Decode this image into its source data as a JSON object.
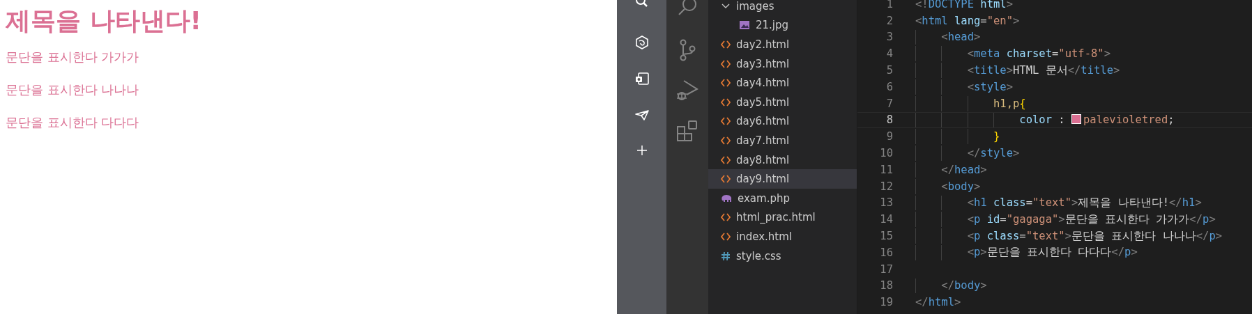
{
  "preview": {
    "heading": "제목을 나타낸다!",
    "paragraphs": [
      "문단을 표시한다 가가가",
      "문단을 표시한다 나나나",
      "문단을 표시한다 다다다"
    ]
  },
  "explorer": {
    "items": [
      {
        "name": "images",
        "kind": "folder",
        "expanded": true,
        "selected": false,
        "children": [
          {
            "name": "21.jpg",
            "kind": "image",
            "selected": false
          }
        ]
      },
      {
        "name": "day2.html",
        "kind": "html",
        "selected": false
      },
      {
        "name": "day3.html",
        "kind": "html",
        "selected": false
      },
      {
        "name": "day4.html",
        "kind": "html",
        "selected": false
      },
      {
        "name": "day5.html",
        "kind": "html",
        "selected": false
      },
      {
        "name": "day6.html",
        "kind": "html",
        "selected": false
      },
      {
        "name": "day7.html",
        "kind": "html",
        "selected": false
      },
      {
        "name": "day8.html",
        "kind": "html",
        "selected": false
      },
      {
        "name": "day9.html",
        "kind": "html",
        "selected": true
      },
      {
        "name": "exam.php",
        "kind": "php",
        "selected": false
      },
      {
        "name": "html_prac.html",
        "kind": "html",
        "selected": false
      },
      {
        "name": "index.html",
        "kind": "html",
        "selected": false
      },
      {
        "name": "style.css",
        "kind": "css",
        "selected": false
      }
    ]
  },
  "editor": {
    "lines": [
      {
        "number": "1",
        "current": false,
        "tokens": [
          {
            "text": "<!",
            "kind": "punct"
          },
          {
            "text": "DOCTYPE",
            "kind": "tag"
          },
          {
            "text": " html",
            "kind": "attr"
          },
          {
            "text": ">",
            "kind": "punct"
          }
        ]
      },
      {
        "number": "2",
        "current": false,
        "tokens": [
          {
            "text": "<",
            "kind": "punct"
          },
          {
            "text": "html",
            "kind": "tag"
          },
          {
            "text": " lang",
            "kind": "attr"
          },
          {
            "text": "=",
            "kind": "text"
          },
          {
            "text": "\"en\"",
            "kind": "string"
          },
          {
            "text": ">",
            "kind": "punct"
          }
        ]
      },
      {
        "number": "3",
        "current": false,
        "tokens": [
          {
            "text": "    <",
            "kind": "punct"
          },
          {
            "text": "head",
            "kind": "tag"
          },
          {
            "text": ">",
            "kind": "punct"
          }
        ]
      },
      {
        "number": "4",
        "current": false,
        "tokens": [
          {
            "text": "        <",
            "kind": "punct"
          },
          {
            "text": "meta",
            "kind": "tag"
          },
          {
            "text": " charset",
            "kind": "attr"
          },
          {
            "text": "=",
            "kind": "text"
          },
          {
            "text": "\"utf-8\"",
            "kind": "string"
          },
          {
            "text": ">",
            "kind": "punct"
          }
        ]
      },
      {
        "number": "5",
        "current": false,
        "tokens": [
          {
            "text": "        <",
            "kind": "punct"
          },
          {
            "text": "title",
            "kind": "tag"
          },
          {
            "text": ">",
            "kind": "punct"
          },
          {
            "text": "HTML 문서",
            "kind": "text"
          },
          {
            "text": "</",
            "kind": "punct"
          },
          {
            "text": "title",
            "kind": "tag"
          },
          {
            "text": ">",
            "kind": "punct"
          }
        ]
      },
      {
        "number": "6",
        "current": false,
        "tokens": [
          {
            "text": "        <",
            "kind": "punct"
          },
          {
            "text": "style",
            "kind": "tag"
          },
          {
            "text": ">",
            "kind": "punct"
          }
        ]
      },
      {
        "number": "7",
        "current": false,
        "tokens": [
          {
            "text": "            h1,p",
            "kind": "selector"
          },
          {
            "text": "{",
            "kind": "brace"
          }
        ]
      },
      {
        "number": "8",
        "current": true,
        "tokens": [
          {
            "text": "                color",
            "kind": "attr"
          },
          {
            "text": " : ",
            "kind": "text"
          },
          {
            "text": "palevioletred",
            "kind": "string",
            "color": "#db7093"
          },
          {
            "text": ";",
            "kind": "text"
          }
        ]
      },
      {
        "number": "9",
        "current": false,
        "tokens": [
          {
            "text": "            }",
            "kind": "brace"
          }
        ]
      },
      {
        "number": "10",
        "current": false,
        "tokens": [
          {
            "text": "        </",
            "kind": "punct"
          },
          {
            "text": "style",
            "kind": "tag"
          },
          {
            "text": ">",
            "kind": "punct"
          }
        ]
      },
      {
        "number": "11",
        "current": false,
        "tokens": [
          {
            "text": "    </",
            "kind": "punct"
          },
          {
            "text": "head",
            "kind": "tag"
          },
          {
            "text": ">",
            "kind": "punct"
          }
        ]
      },
      {
        "number": "12",
        "current": false,
        "tokens": [
          {
            "text": "    <",
            "kind": "punct"
          },
          {
            "text": "body",
            "kind": "tag"
          },
          {
            "text": ">",
            "kind": "punct"
          }
        ]
      },
      {
        "number": "13",
        "current": false,
        "tokens": [
          {
            "text": "        <",
            "kind": "punct"
          },
          {
            "text": "h1",
            "kind": "tag"
          },
          {
            "text": " class",
            "kind": "attr"
          },
          {
            "text": "=",
            "kind": "text"
          },
          {
            "text": "\"text\"",
            "kind": "string"
          },
          {
            "text": ">",
            "kind": "punct"
          },
          {
            "text": "제목을 나타낸다!",
            "kind": "text"
          },
          {
            "text": "</",
            "kind": "punct"
          },
          {
            "text": "h1",
            "kind": "tag"
          },
          {
            "text": ">",
            "kind": "punct"
          }
        ]
      },
      {
        "number": "14",
        "current": false,
        "tokens": [
          {
            "text": "        <",
            "kind": "punct"
          },
          {
            "text": "p",
            "kind": "tag"
          },
          {
            "text": " id",
            "kind": "attr"
          },
          {
            "text": "=",
            "kind": "text"
          },
          {
            "text": "\"gagaga\"",
            "kind": "string"
          },
          {
            "text": ">",
            "kind": "punct"
          },
          {
            "text": "문단을 표시한다 가가가",
            "kind": "text"
          },
          {
            "text": "</",
            "kind": "punct"
          },
          {
            "text": "p",
            "kind": "tag"
          },
          {
            "text": ">",
            "kind": "punct"
          }
        ]
      },
      {
        "number": "15",
        "current": false,
        "tokens": [
          {
            "text": "        <",
            "kind": "punct"
          },
          {
            "text": "p",
            "kind": "tag"
          },
          {
            "text": " class",
            "kind": "attr"
          },
          {
            "text": "=",
            "kind": "text"
          },
          {
            "text": "\"text\"",
            "kind": "string"
          },
          {
            "text": ">",
            "kind": "punct"
          },
          {
            "text": "문단을 표시한다 나나나",
            "kind": "text"
          },
          {
            "text": "</",
            "kind": "punct"
          },
          {
            "text": "p",
            "kind": "tag"
          },
          {
            "text": ">",
            "kind": "punct"
          }
        ]
      },
      {
        "number": "16",
        "current": false,
        "tokens": [
          {
            "text": "        <",
            "kind": "punct"
          },
          {
            "text": "p",
            "kind": "tag"
          },
          {
            "text": ">",
            "kind": "punct"
          },
          {
            "text": "문단을 표시한다 다다다",
            "kind": "text"
          },
          {
            "text": "</",
            "kind": "punct"
          },
          {
            "text": "p",
            "kind": "tag"
          },
          {
            "text": ">",
            "kind": "punct"
          }
        ]
      },
      {
        "number": "17",
        "current": false
      },
      {
        "number": "18",
        "current": false,
        "tokens": [
          {
            "text": "    </",
            "kind": "punct"
          },
          {
            "text": "body",
            "kind": "tag"
          },
          {
            "text": ">",
            "kind": "punct"
          }
        ]
      },
      {
        "number": "19",
        "current": false,
        "tokens": [
          {
            "text": "</",
            "kind": "punct"
          },
          {
            "text": "html",
            "kind": "tag"
          },
          {
            "text": ">",
            "kind": "punct"
          }
        ]
      }
    ]
  }
}
